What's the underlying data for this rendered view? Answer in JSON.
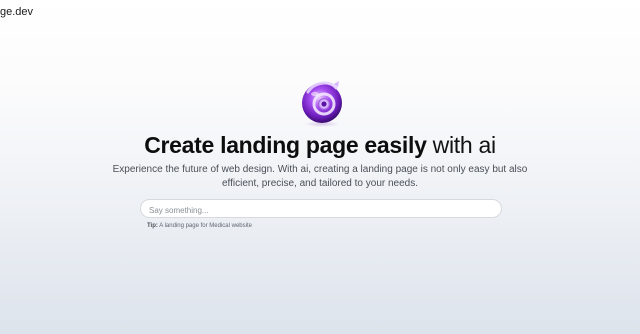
{
  "header": {
    "brand_text": "ge.dev"
  },
  "logo": {
    "icon": "swirl-orb-logo",
    "primary_color": "#8a2be2"
  },
  "hero": {
    "headline_bold": "Create landing page easily",
    "headline_light": " with ai",
    "subtitle_line1": "Experience the future of web design. With ai, creating a landing page is not only easy but also",
    "subtitle_line2": "efficient, precise, and tailored to your needs."
  },
  "search": {
    "placeholder": "Say something...",
    "value": ""
  },
  "tip": {
    "label": "Tip:",
    "text": " A landing page for Medical website"
  }
}
